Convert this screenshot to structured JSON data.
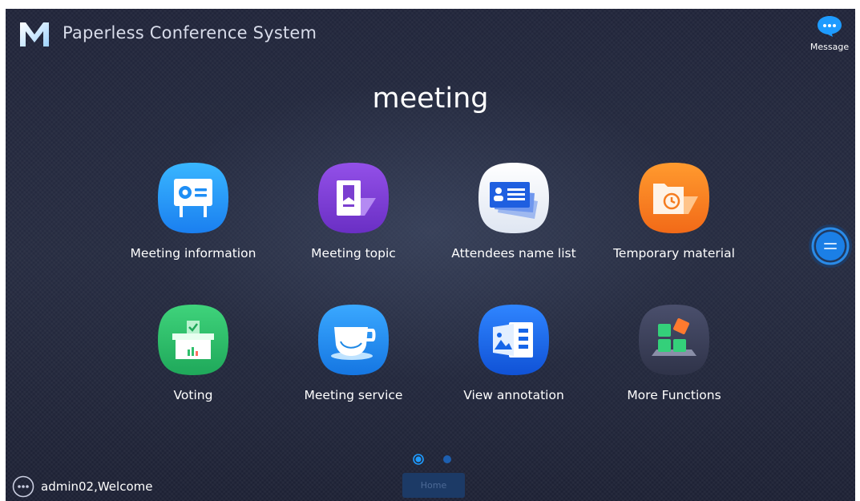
{
  "header": {
    "app_title": "Paperless Conference System",
    "logo_letter": "M",
    "message_label": "Message"
  },
  "main": {
    "heading": "meeting"
  },
  "apps": [
    {
      "label": "Meeting information",
      "icon": "presentation-board-icon",
      "color": "#2196f3"
    },
    {
      "label": "Meeting topic",
      "icon": "bookmark-document-icon",
      "color": "#7b3fd0"
    },
    {
      "label": "Attendees name list",
      "icon": "name-card-icon",
      "color": "#eef2f8"
    },
    {
      "label": "Temporary material",
      "icon": "folder-clock-icon",
      "color": "#f57c1f"
    },
    {
      "label": "Voting",
      "icon": "ballot-box-icon",
      "color": "#2fbf6c"
    },
    {
      "label": "Meeting service",
      "icon": "tea-cup-icon",
      "color": "#1e88e5"
    },
    {
      "label": "View annotation",
      "icon": "annotation-document-icon",
      "color": "#1565e8"
    },
    {
      "label": "More Functions",
      "icon": "app-blocks-icon",
      "color": "#3a3f58"
    }
  ],
  "pagination": {
    "pages": 2,
    "current": 1
  },
  "footer": {
    "welcome_text": "admin02,Welcome",
    "home_label": "Home"
  },
  "colors": {
    "accent": "#1e9bff",
    "background": "#23273a"
  }
}
